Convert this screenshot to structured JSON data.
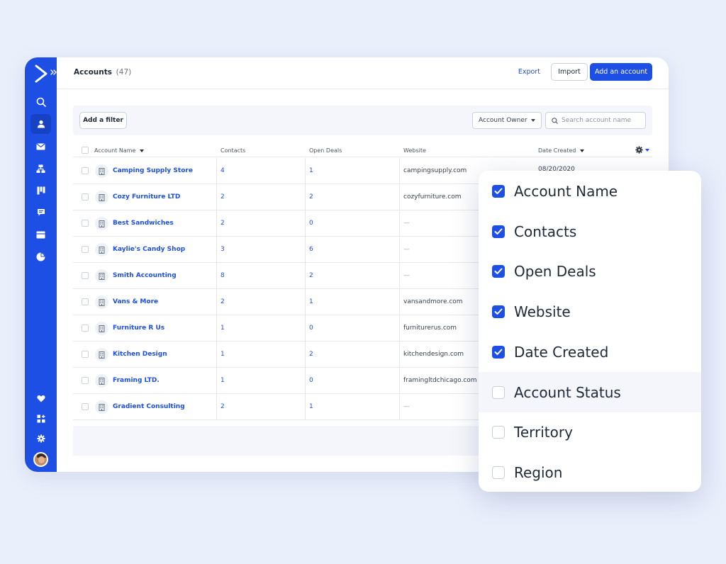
{
  "header": {
    "title": "Accounts",
    "count": "(47)",
    "export_label": "Export",
    "import_label": "Import",
    "add_label": "Add an account"
  },
  "filters": {
    "add_filter_label": "Add a filter",
    "owner_label": "Account Owner",
    "search_placeholder": "Search account name"
  },
  "table": {
    "columns": [
      "Account Name",
      "Contacts",
      "Open Deals",
      "Website",
      "Date Created"
    ],
    "rows": [
      {
        "name": "Camping Supply Store",
        "contacts": "4",
        "deals": "1",
        "website": "campingsupply.com",
        "date": "08/20/2020"
      },
      {
        "name": "Cozy Furniture LTD",
        "contacts": "2",
        "deals": "2",
        "website": "cozyfurniture.com",
        "date": ""
      },
      {
        "name": "Best Sandwiches",
        "contacts": "2",
        "deals": "0",
        "website": "—",
        "date": ""
      },
      {
        "name": "Kaylie's Candy Shop",
        "contacts": "3",
        "deals": "6",
        "website": "—",
        "date": ""
      },
      {
        "name": "Smith Accounting",
        "contacts": "8",
        "deals": "2",
        "website": "—",
        "date": ""
      },
      {
        "name": "Vans & More",
        "contacts": "2",
        "deals": "1",
        "website": "vansandmore.com",
        "date": ""
      },
      {
        "name": "Furniture R Us",
        "contacts": "1",
        "deals": "0",
        "website": "furniturerus.com",
        "date": ""
      },
      {
        "name": "Kitchen Design",
        "contacts": "1",
        "deals": "2",
        "website": "kitchendesign.com",
        "date": ""
      },
      {
        "name": "Framing LTD.",
        "contacts": "1",
        "deals": "0",
        "website": "framingltdchicago.com",
        "date": ""
      },
      {
        "name": "Gradient Consulting",
        "contacts": "2",
        "deals": "1",
        "website": "—",
        "date": ""
      }
    ]
  },
  "column_picker": {
    "options": [
      {
        "label": "Account Name",
        "checked": true
      },
      {
        "label": "Contacts",
        "checked": true
      },
      {
        "label": "Open Deals",
        "checked": true
      },
      {
        "label": "Website",
        "checked": true
      },
      {
        "label": "Date Created",
        "checked": true
      },
      {
        "label": "Account Status",
        "checked": false
      },
      {
        "label": "Territory",
        "checked": false
      },
      {
        "label": "Region",
        "checked": false
      }
    ]
  },
  "colors": {
    "accent": "#1d4fe4",
    "background": "#eaeffc"
  },
  "sidebar_icons": [
    "search-icon",
    "contacts-icon",
    "email-icon",
    "automations-icon",
    "deals-icon",
    "conversations-icon",
    "site-icon",
    "reports-icon",
    "heart-icon",
    "apps-icon",
    "settings-icon"
  ]
}
